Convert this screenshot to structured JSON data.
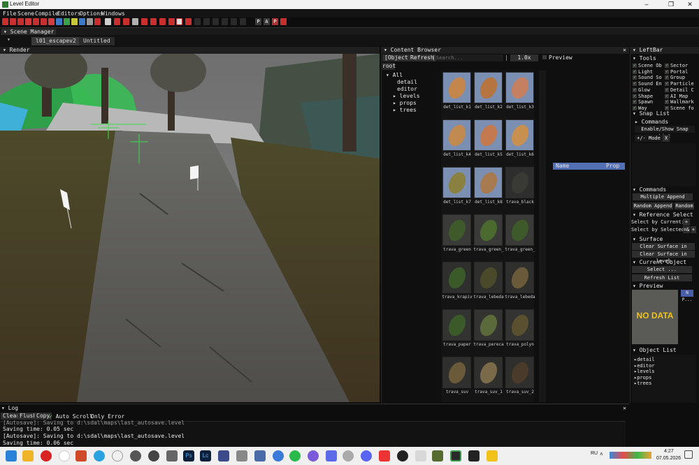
{
  "window": {
    "title": "Level Editor",
    "minimize": "–",
    "maximize": "❐",
    "close": "✕"
  },
  "menu": [
    "File",
    "Scene",
    "Compile",
    "Editors",
    "Options",
    "Windows"
  ],
  "toolbar": {
    "letters": [
      "P",
      "A",
      "P"
    ]
  },
  "scene_manager": {
    "title": "Scene Manager",
    "tabs": [
      "l01_escapev2",
      "Untitled"
    ]
  },
  "render": {
    "title": "Render"
  },
  "content_browser": {
    "title": "Content Browser",
    "objects_btn": "[Objects]",
    "refresh_btn": "Refresh",
    "search_placeholder": "Search...",
    "zoom": "1.0x",
    "preview_label": "Preview",
    "root_label": "root",
    "tree": [
      "All",
      "detail",
      "editor",
      "levels",
      "props",
      "trees"
    ],
    "props_header": {
      "name": "Name",
      "prop": "Prop"
    },
    "items": [
      "det_list_k1",
      "det_list_k2",
      "det_list_k3",
      "det_list_k4",
      "det_list_k5",
      "det_list_k6",
      "det_list_k7",
      "det_list_k8",
      "trava_black",
      "trava_green",
      "trava_green_",
      "trava_green_",
      "trava_krapiv",
      "trava_lebeda",
      "trava_lebeda",
      "trava_paper",
      "trava_pereca",
      "trava_polyn",
      "trava_suv",
      "trava_suv_1",
      "trava_suv_2"
    ]
  },
  "leftbar": {
    "title": "LeftBar",
    "tools_title": "Tools",
    "tools_left": [
      "Scene Ob",
      "Light",
      "Sound So",
      "Sound En",
      "Glow",
      "Shape",
      "Spawn",
      "Way"
    ],
    "tools_right": [
      "Sector",
      "Portal",
      "Group",
      "Particle",
      "Detail C",
      "AI Map",
      "Wallmark",
      "Scene fo"
    ],
    "snap_list_title": "Snap List",
    "commands_sub": "Commands",
    "enable_snap": "Enable/Show Snap List",
    "mode_label": "+/- Mode",
    "mode_x": "X",
    "commands_title": "Commands",
    "multiple_append": "Multiple Append",
    "random_append": "Random Append",
    "random": "Random",
    "ref_select_title": "Reference Select",
    "select_by_current": "Select by Current:",
    "select_by_selected": "Select by Selected:",
    "plus": "+",
    "minus_eq": "=&",
    "surface_title": "Surface",
    "clear_surface_select": "Clear Surface in select",
    "clear_surface_level": "Clear Surface in level",
    "current_object_title": "Current Object",
    "select_btn": "Select ...",
    "refresh_list": "Refresh List",
    "preview_title": "Preview",
    "no_data": "NO DATA",
    "preview_side": "N P...",
    "object_list_title": "Object List",
    "object_list": [
      "detail",
      "editor",
      "levels",
      "props",
      "trees"
    ]
  },
  "log": {
    "title": "Log",
    "clear": "Clear",
    "flush": "Flush",
    "copy": "Copy",
    "auto_scroll": "Auto Scroll",
    "only_error": "Only Error",
    "lines": [
      "[Autosave]: Saving to d:\\sdal\\maps\\last_autosave.level",
      "Saving time: 0.05 sec",
      "[Autosave]: Saving to d:\\sdal\\maps\\last_autosave.level",
      "Saving time: 0.06 sec"
    ]
  },
  "taskbar": {
    "lang": "RU",
    "time": "4:27",
    "date": "07.05.2026",
    "ps": "Ps",
    "lr": "Lc"
  },
  "colors": {
    "accent_blue": "#2c6fbf",
    "panel_bg": "#0f0f0f",
    "prop_header": "#5470b5"
  }
}
